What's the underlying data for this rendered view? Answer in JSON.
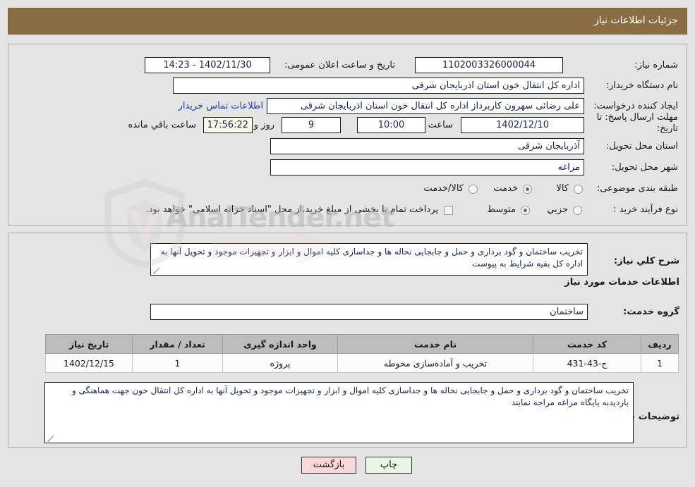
{
  "header": {
    "title": "جزئیات اطلاعات نیاز",
    "bar_color": "#8a6d42"
  },
  "top_section": {
    "need_number": {
      "label": "شماره نیاز:",
      "value": "1102003326000044"
    },
    "announce_datetime": {
      "label": "تاریخ و ساعت اعلان عمومی:",
      "value": "1402/11/30 - 14:23"
    },
    "buyer_org": {
      "label": "نام دستگاه خریدار:",
      "value": "اداره کل انتقال خون استان اذربایجان شرقی"
    },
    "request_creator": {
      "label": "ایجاد کننده درخواست:",
      "value": "علی رضائی سهرون کاربرداز اداره کل انتقال خون استان اذربایجان شرقی"
    },
    "contact_link": "اطلاعات تماس خریدار",
    "deadline": {
      "label": "مهلت ارسال پاسخ: تا تاریخ:",
      "date": "1402/12/10",
      "hour_label": "ساعت",
      "hour": "10:00",
      "days": "9",
      "days_suffix": "روز و",
      "countdown": "17:56:22",
      "countdown_suffix": "ساعت باقي مانده"
    },
    "province": {
      "label": "استان محل تحویل:",
      "value": "آذربایجان شرقی"
    },
    "city": {
      "label": "شهر محل تحویل:",
      "value": "مراغه"
    },
    "category": {
      "label": "طبقه بندی موضوعی:",
      "options": [
        "کالا",
        "خدمت",
        "کالا/خدمت"
      ],
      "selected": "خدمت"
    },
    "purchase_process": {
      "label": "نوع فرآیند خرید :",
      "options": [
        "جزیي",
        "متوسط"
      ],
      "selected": "متوسط"
    },
    "treasury_note": {
      "checked": false,
      "text": "پرداخت تمام یا بخشی از مبلغ خرید،از محل \"اسناد خزانه اسلامی\" خواهد بود."
    }
  },
  "mid_section": {
    "general_desc": {
      "label": "شرح کلي نیاز:",
      "value": "تخریب ساختمان و گود برداری و حمل و جابجایی نخاله ها و جداسازی کلیه اموال و ابزار و تجهیزات موجود و تحویل آنها به اداره کل بقیه شرایط به پیوست"
    },
    "services_heading": "اطلاعات خدمات مورد نیاز",
    "service_group": {
      "label": "گروه خدمت:",
      "value": "ساختمان"
    },
    "table": {
      "columns": [
        "ردیف",
        "کد خدمت",
        "نام خدمت",
        "واحد اندازه گیری",
        "تعداد / مقدار",
        "تاریخ نیاز"
      ],
      "rows": [
        {
          "row_no": "1",
          "service_code": "ج-43-431",
          "service_name": "تخریب و آماده‌سازی محوطه",
          "unit": "پروژه",
          "quantity": "1",
          "need_date": "1402/12/15"
        }
      ]
    },
    "buyer_notes": {
      "label": "توضیحات خریدار:",
      "value": "تخریب ساختمان و گود برداری و حمل و جابجایی نخاله ها و جداسازی کلیه اموال و ابزار و تجهیزات موجود و تحویل آنها به اداره کل انتقال خون جهت هماهنگی و بازدیدبه پایگاه مراغه مراجه نمایند"
    }
  },
  "footer": {
    "print_label": "چاپ",
    "back_label": "بازگشت"
  },
  "watermark": {
    "text": "AnalTender.net"
  }
}
